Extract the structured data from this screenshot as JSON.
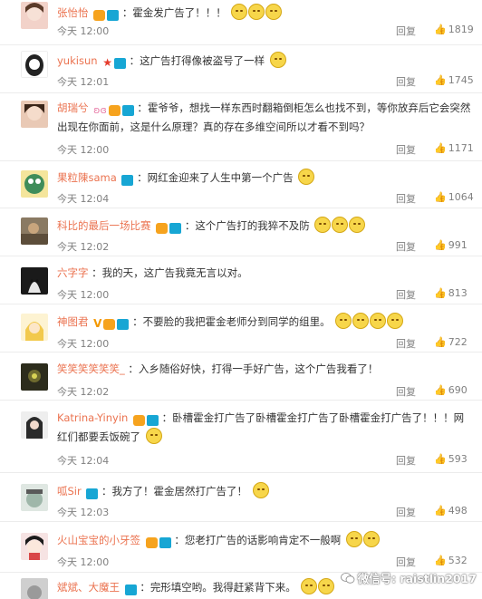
{
  "comments": [
    {
      "username": "张怡怡",
      "text": "霍金发广告了！！！",
      "emoji_count": 3,
      "time": "今天 12:00",
      "reply": "回复",
      "likes": "1819"
    },
    {
      "username": "yukisun",
      "text": "这广告打得像被盗号了一样",
      "emoji_count": 1,
      "time": "今天 12:01",
      "reply": "回复",
      "likes": "1745"
    },
    {
      "username": "胡瑞兮",
      "text": "霍爷爷，想找一样东西时翻箱倒柜怎么也找不到，等你放弃后它会突然出现在你面前，这是什么原理？真的存在多维空间所以才看不到吗？",
      "emoji_count": 0,
      "time": "今天 12:00",
      "reply": "回复",
      "likes": "1171"
    },
    {
      "username": "果粒陳sama",
      "text": "网红金迎来了人生中第一个广告",
      "emoji_count": 1,
      "time": "今天 12:04",
      "reply": "回复",
      "likes": "1064"
    },
    {
      "username": "科比的最后一场比赛",
      "text": "这个广告打的我猝不及防",
      "emoji_count": 3,
      "time": "今天 12:02",
      "reply": "回复",
      "likes": "991"
    },
    {
      "username": "六字字",
      "text": "我的天，这广告我竟无言以对。",
      "emoji_count": 0,
      "time": "今天 12:00",
      "reply": "回复",
      "likes": "813"
    },
    {
      "username": "神图君",
      "text": "不要脸的我把霍金老师分到同学的组里。",
      "emoji_count": 4,
      "time": "今天 12:00",
      "reply": "回复",
      "likes": "722"
    },
    {
      "username": "笑笑笑笑笑笑_",
      "text": "入乡随俗好快，打得一手好广告，这个广告我看了！",
      "emoji_count": 0,
      "time": "今天 12:02",
      "reply": "回复",
      "likes": "690"
    },
    {
      "username": "Katrina-Yinyin",
      "text": "卧槽霍金打广告了卧槽霍金打广告了卧槽霍金打广告了！！！网红们都要丢饭碗了",
      "emoji_count": 1,
      "time": "今天 12:04",
      "reply": "回复",
      "likes": "593"
    },
    {
      "username": "呱Sir",
      "text": "我方了！霍金居然打广告了！",
      "emoji_count": 1,
      "time": "今天 12:03",
      "reply": "回复",
      "likes": "498"
    },
    {
      "username": "火山宝宝的小牙签",
      "text": "您老打广告的话影响肯定不一般啊",
      "emoji_count": 2,
      "time": "今天 12:00",
      "reply": "回复",
      "likes": "532"
    },
    {
      "username": "斌斌、大魔王",
      "text": "完形填空哟。我得赶紧背下来。",
      "emoji_count": 2,
      "time": "",
      "reply": "",
      "likes": ""
    }
  ],
  "watermark": "微信号: raistlin2017",
  "colors": {
    "username": "#eb7350",
    "meta": "#808080",
    "text": "#333333"
  }
}
